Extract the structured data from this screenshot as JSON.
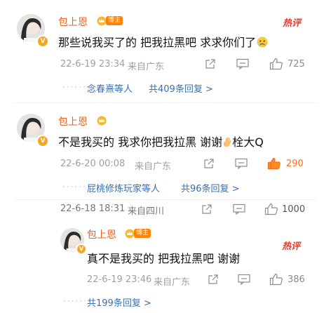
{
  "comments": [
    {
      "author": "包上恩",
      "badge": "博主",
      "hot_label": "热评",
      "text": "那些说我买了的 把我拉黑吧 求求你们了",
      "emoji": "crying-face",
      "date": "22-6-19 23:34",
      "location": "来自广东",
      "likes": "725",
      "reply_users": "念春熹等人",
      "reply_count_text": "共409条回复 >"
    },
    {
      "author": "包上恩",
      "text": "不是我买的 我求你把我拉黑 谢谢",
      "suffix": "栓大Q",
      "date": "22-6-20 00:08",
      "location": "来自广东",
      "likes": "290",
      "reply_users": "屁桃修炼玩家等人",
      "reply_count_text": "共96条回复 >"
    },
    {
      "date": "22-6-18 18:31",
      "location": "来自四川",
      "likes": "1000"
    },
    {
      "author": "包上恩",
      "badge": "博主",
      "hot_label": "热评",
      "text": "真不是我买的 把我拉黑吧 谢谢",
      "date": "22-6-19 23:46",
      "location": "来自广东",
      "likes": "386",
      "reply_count_text": "共199条回复 >"
    }
  ],
  "colors": {
    "name": "#e8621f",
    "hot": "#e33b2f",
    "link": "#3a6fb0",
    "meta": "#a0a0a0",
    "like_active": "#ff6c17"
  },
  "icons": [
    "share-icon",
    "comment-icon",
    "like-icon",
    "crown-icon",
    "v-badge-icon"
  ]
}
